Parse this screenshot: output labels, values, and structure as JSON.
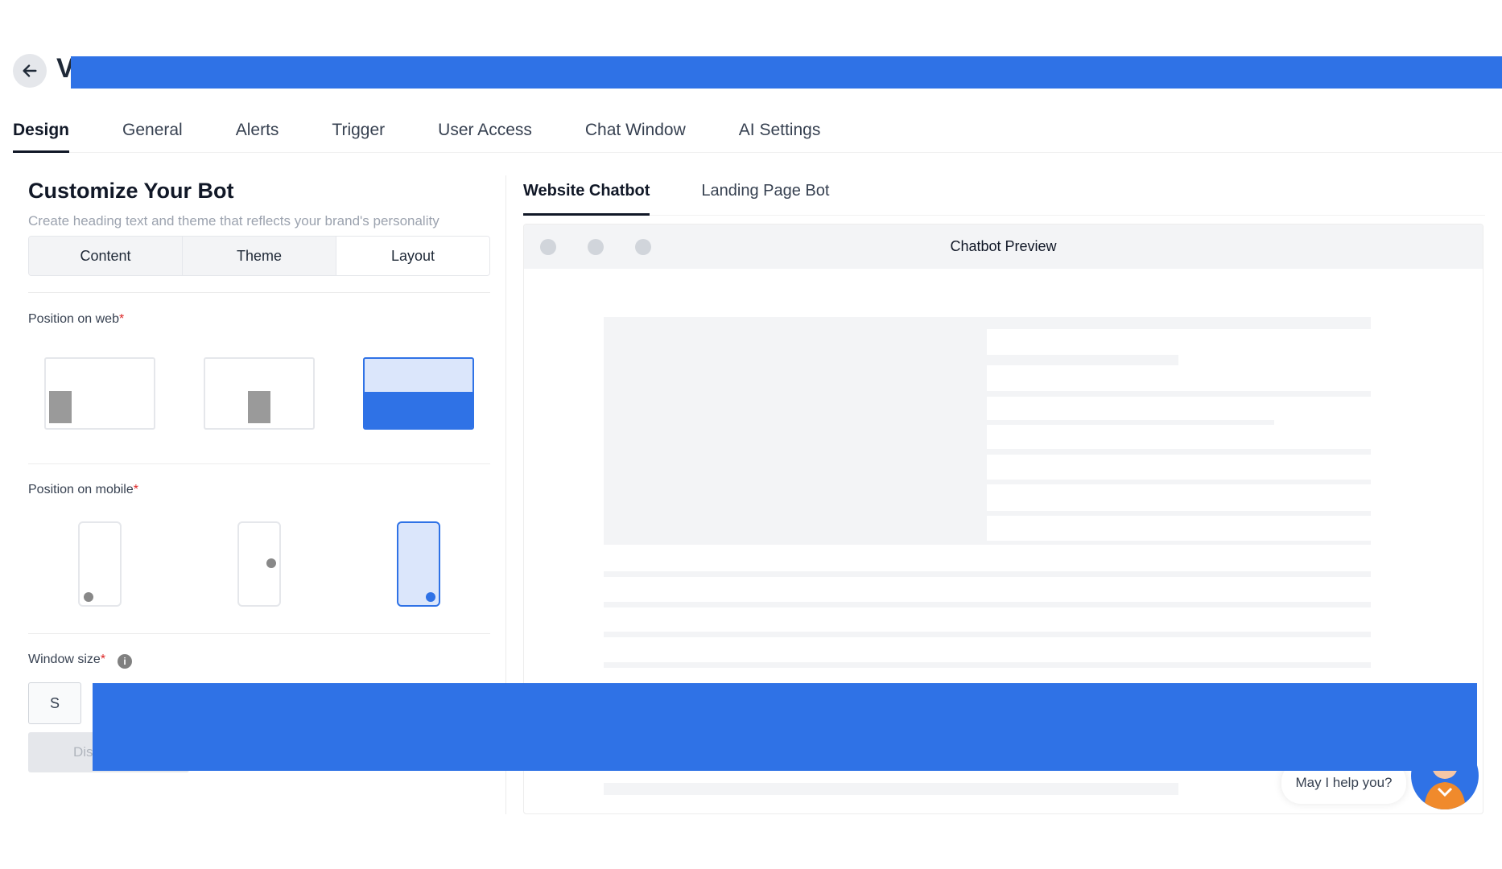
{
  "header": {
    "back_label": "",
    "title": "V"
  },
  "main_tabs": [
    {
      "label": "Design",
      "active": true
    },
    {
      "label": "General",
      "active": false
    },
    {
      "label": "Alerts",
      "active": false
    },
    {
      "label": "Trigger",
      "active": false
    },
    {
      "label": "User Access",
      "active": false
    },
    {
      "label": "Chat Window",
      "active": false
    },
    {
      "label": "AI Settings",
      "active": false
    }
  ],
  "left": {
    "title": "Customize Your Bot",
    "subtitle": "Create heading text and theme that reflects your brand's personality",
    "segments": [
      "Content",
      "Theme",
      "Layout"
    ],
    "position_web_label": "Position on web",
    "position_mobile_label": "Position on mobile",
    "window_size_label": "Window size",
    "required_mark": "*",
    "info_glyph": "i",
    "size_option": "S",
    "disabled_button_text": "Dis"
  },
  "right": {
    "sub_tabs": [
      {
        "label": "Website Chatbot",
        "active": true
      },
      {
        "label": "Landing Page Bot",
        "active": false
      }
    ],
    "preview_title": "Chatbot Preview",
    "chat_bubble": "May I help you?"
  },
  "colors": {
    "accent": "#2f72e6",
    "selected_bg": "#dbe6fb",
    "text_dark": "#111827",
    "muted": "#9ca3af",
    "required": "#dc2626"
  }
}
